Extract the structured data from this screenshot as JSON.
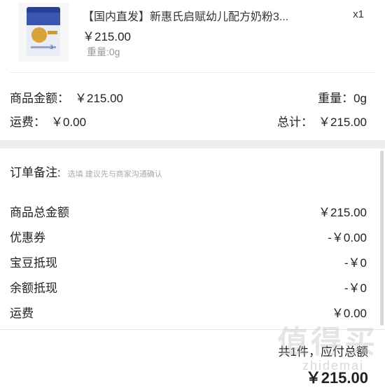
{
  "product": {
    "title": "【国内直发】新惠氏启赋幼儿配方奶粉3...",
    "quantity": "x1",
    "price": "￥215.00",
    "weight": "重量:0g"
  },
  "summary_top": {
    "goods_amount_label": "商品金额：",
    "goods_amount_value": "￥215.00",
    "weight_label": "重量：",
    "weight_value": "0g",
    "shipping_label": "运费：",
    "shipping_value": "￥0.00",
    "total_label": "总计：",
    "total_value": "￥215.00"
  },
  "note": {
    "label": "订单备注:",
    "placeholder": "选填 建议先与商家沟通确认"
  },
  "breakdown": [
    {
      "label": "商品总金额",
      "value": "￥215.00"
    },
    {
      "label": "优惠券",
      "value": "-￥0.00"
    },
    {
      "label": "宝豆抵现",
      "value": "-￥0"
    },
    {
      "label": "余额抵现",
      "value": "-￥0"
    },
    {
      "label": "运费",
      "value": "￥0.00"
    }
  ],
  "footer": {
    "count_text": "共1件，应付总额",
    "total": "￥215.00"
  },
  "watermark": {
    "main": "值得买",
    "sub": "zhidemai"
  }
}
